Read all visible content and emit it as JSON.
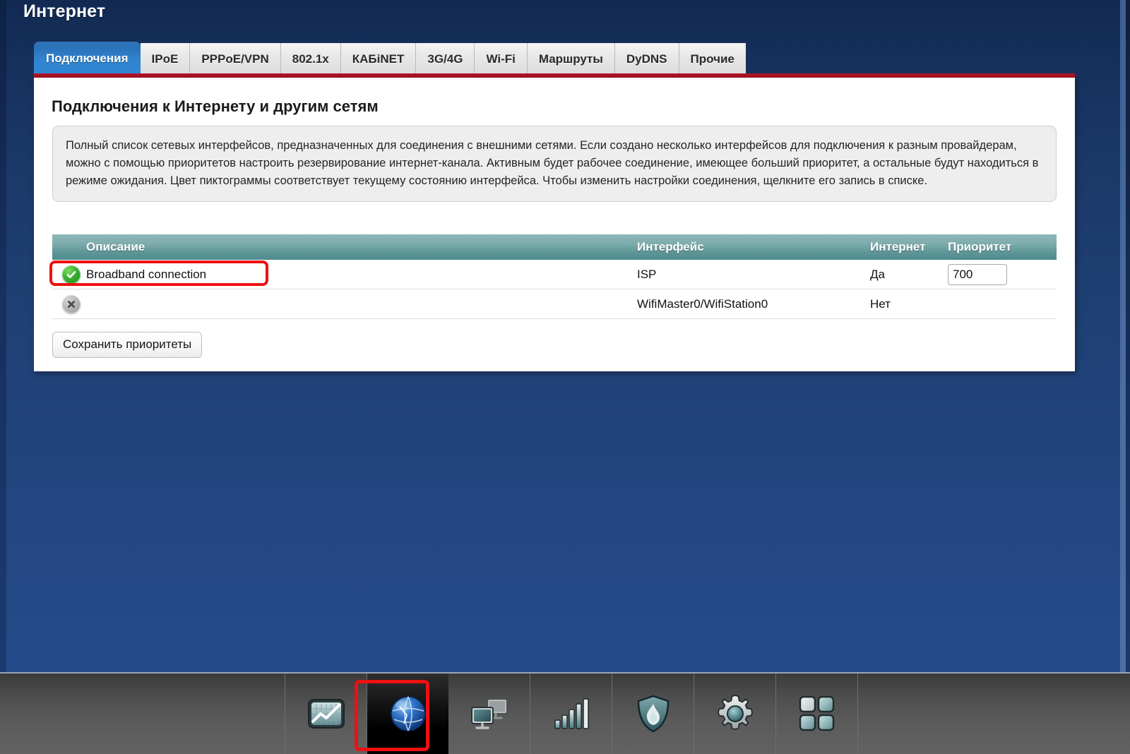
{
  "page": {
    "title": "Интернет"
  },
  "tabs": [
    {
      "label": "Подключения",
      "active": true
    },
    {
      "label": "IPoE",
      "active": false
    },
    {
      "label": "PPPoE/VPN",
      "active": false
    },
    {
      "label": "802.1x",
      "active": false
    },
    {
      "label": "КАБiNET",
      "active": false
    },
    {
      "label": "3G/4G",
      "active": false
    },
    {
      "label": "Wi-Fi",
      "active": false
    },
    {
      "label": "Маршруты",
      "active": false
    },
    {
      "label": "DyDNS",
      "active": false
    },
    {
      "label": "Прочие",
      "active": false
    }
  ],
  "panel": {
    "heading": "Подключения к Интернету и другим сетям",
    "info_text": "Полный список сетевых интерфейсов, предназначенных для соединения с внешними сетями. Если создано несколько интерфейсов для подключения к разным провайдерам, можно с помощью приоритетов настроить резервирование интернет-канала. Активным будет рабочее соединение, имеющее больший приоритет, а остальные будут находиться в режиме ожидания. Цвет пиктограммы соответствует текущему состоянию интерфейса. Чтобы изменить настройки соединения, щелкните его запись в списке.",
    "save_button": "Сохранить приоритеты"
  },
  "table": {
    "headers": {
      "description": "Описание",
      "interface": "Интерфейс",
      "internet": "Интернет",
      "priority": "Приоритет"
    },
    "rows": [
      {
        "status_icon": "check-circle-green-icon",
        "description": "Broadband connection",
        "interface": "ISP",
        "internet": "Да",
        "priority": "700",
        "has_priority_input": true
      },
      {
        "status_icon": "x-circle-gray-icon",
        "description": "",
        "interface": "WifiMaster0/WifiStation0",
        "internet": "Нет",
        "priority": "",
        "has_priority_input": false
      }
    ]
  },
  "taskbar": {
    "items": [
      {
        "icon": "chart-monitor-icon",
        "selected": false
      },
      {
        "icon": "globe-internet-icon",
        "selected": true
      },
      {
        "icon": "network-monitors-icon",
        "selected": false
      },
      {
        "icon": "signal-bars-icon",
        "selected": false
      },
      {
        "icon": "firewall-shield-icon",
        "selected": false
      },
      {
        "icon": "gear-settings-icon",
        "selected": false
      },
      {
        "icon": "apps-grid-icon",
        "selected": false
      }
    ]
  },
  "colors": {
    "accent_blue": "#2f86d4",
    "red_underline": "#b3152a",
    "table_header_teal": "#5f9698",
    "highlight_red": "#ee1111",
    "status_ok_green": "#34ad2e",
    "status_off_gray": "#b6b6b6"
  }
}
